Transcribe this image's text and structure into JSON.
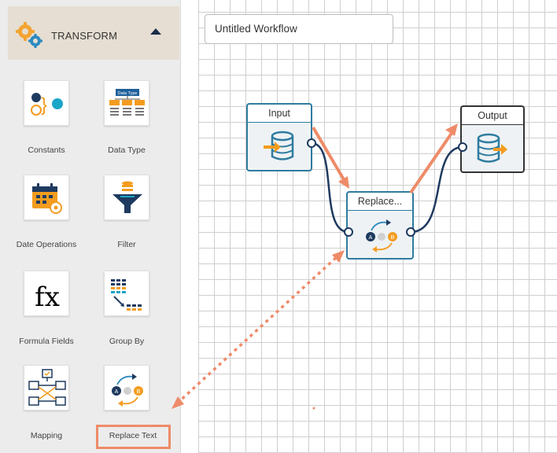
{
  "sidebar": {
    "header": {
      "label": "TRANSFORM",
      "icon": "gears-icon",
      "toggle_icon": "collapse-up-icon"
    },
    "tools": [
      {
        "label": "Constants",
        "icon": "constants-icon"
      },
      {
        "label": "Data Type",
        "icon": "data-type-icon",
        "icon_text": "Data Type"
      },
      {
        "label": "Date Operations",
        "icon": "date-operations-icon"
      },
      {
        "label": "Filter",
        "icon": "filter-icon"
      },
      {
        "label": "Formula Fields",
        "icon": "formula-fields-icon",
        "icon_text": "fx"
      },
      {
        "label": "Group By",
        "icon": "group-by-icon"
      },
      {
        "label": "Mapping",
        "icon": "mapping-icon"
      },
      {
        "label": "Replace Text",
        "icon": "replace-text-icon",
        "highlighted": true
      }
    ]
  },
  "canvas": {
    "workflow_name": "Untitled Workflow",
    "nodes": [
      {
        "title": "Input",
        "icon": "database-input-icon"
      },
      {
        "title": "Replace...",
        "icon": "replace-text-icon"
      },
      {
        "title": "Output",
        "icon": "database-output-icon"
      }
    ]
  },
  "colors": {
    "accent": "#2f7ca0",
    "annotation": "#ee8b68",
    "sidebar_header": "#e6ded2",
    "orange": "#f39c1f",
    "navy": "#1e3a5f"
  }
}
